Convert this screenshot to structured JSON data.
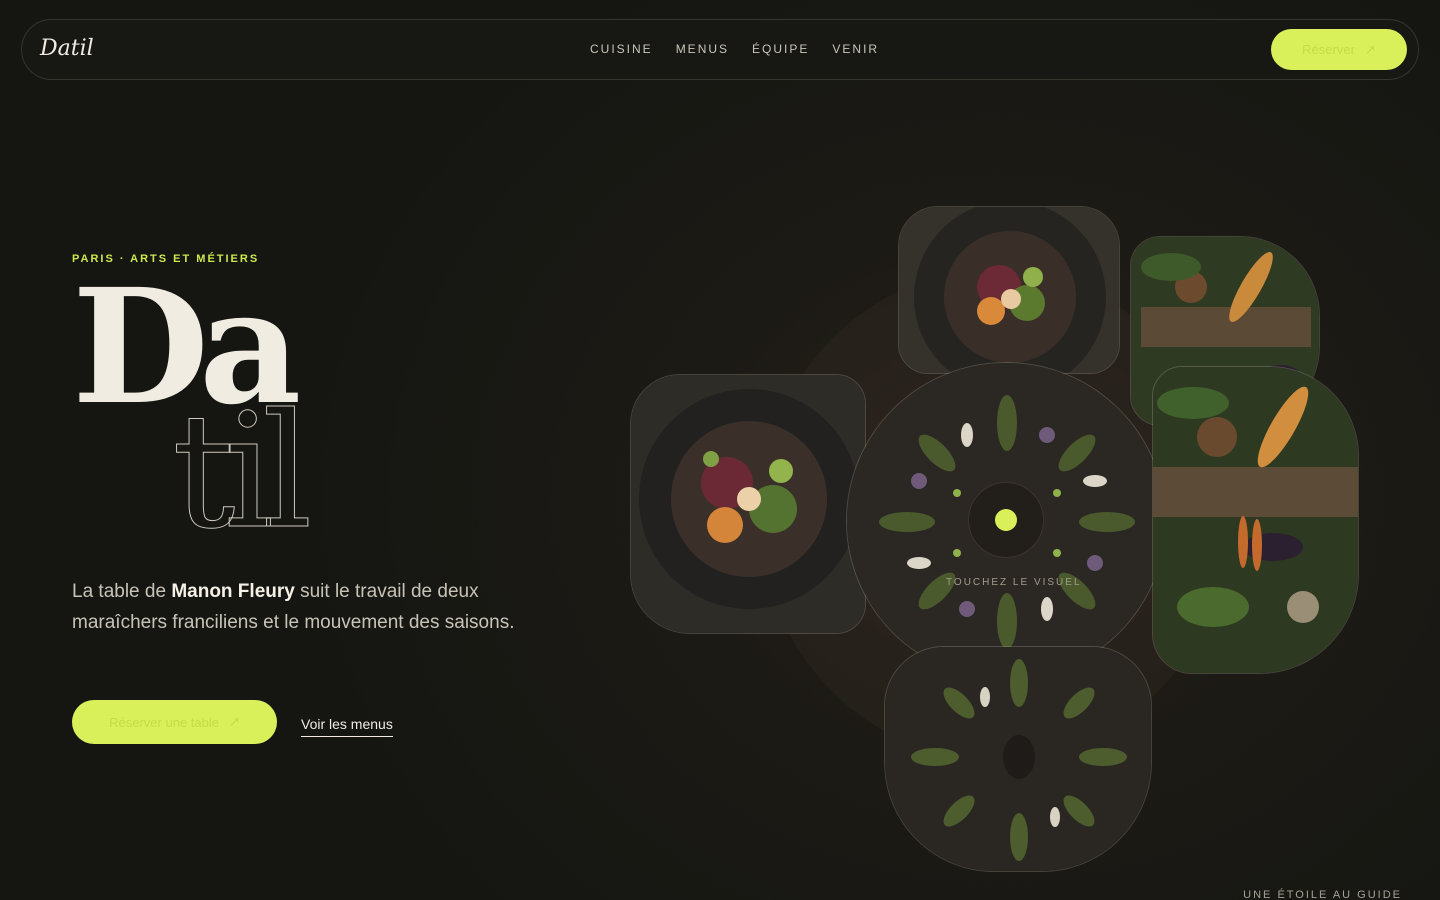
{
  "nav": {
    "logo": "Datil",
    "links": [
      "CUISINE",
      "MENUS",
      "ÉQUIPE",
      "VENIR"
    ],
    "cta_label": "Réserver",
    "cta_icon": "arrow-icon"
  },
  "hero": {
    "eyebrow": "PARIS · ARTS ET MÉTIERS",
    "title_part1": "Da",
    "title_part2": "til",
    "intro_prefix": "La table de ",
    "intro_name": "Manon Fleury",
    "intro_suffix": " suit le travail de deux maraîchers franciliens et le mouvement des saisons.",
    "primary_cta": "Réserver une table",
    "primary_cta_icon": "arrow-icon",
    "secondary_cta": "Voir les menus"
  },
  "collage": {
    "hint": "TOUCHEZ LE VISUEL",
    "accent_color": "#d9f05a"
  },
  "footnote": "UNE ÉTOILE AU GUIDE",
  "colors": {
    "background": "#1a1915",
    "accent": "#d9f05a",
    "text": "#f0ece2"
  }
}
